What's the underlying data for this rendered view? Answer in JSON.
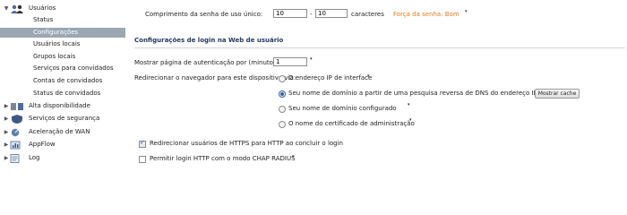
{
  "sidebar": {
    "sections": [
      {
        "label": "Usuários",
        "expanded": true,
        "icon": "users-icon"
      },
      {
        "label": "Alta disponibilidade",
        "icon": "high-availability-icon"
      },
      {
        "label": "Serviços de segurança",
        "icon": "security-services-icon"
      },
      {
        "label": "Aceleração de WAN",
        "icon": "wan-acceleration-icon"
      },
      {
        "label": "AppFlow",
        "icon": "appflow-icon"
      },
      {
        "label": "Log",
        "icon": "log-icon"
      }
    ],
    "users_children": [
      {
        "label": "Status"
      },
      {
        "label": "Configurações",
        "selected": true
      },
      {
        "label": "Usuários locais"
      },
      {
        "label": "Grupos locais"
      },
      {
        "label": "Serviços para convidados"
      },
      {
        "label": "Contas de convidados"
      },
      {
        "label": "Status de convidados"
      }
    ]
  },
  "password": {
    "label": "Comprimento da senha de uso único:",
    "min_value": "10",
    "separator": "-",
    "max_value": "10",
    "unit": "caracteres",
    "strength": "Força da senha: Bom",
    "strength_color": "#e07b1a"
  },
  "web_login": {
    "title": "Configurações de login na Web de usuário",
    "show_auth_label": "Mostrar página de autenticação por (minutos):",
    "show_auth_value": "1",
    "redirect_label": "Redirecionar o navegador para este dispositivo via:",
    "options": [
      {
        "label": "O endereço IP de interface",
        "checked": false
      },
      {
        "label": "Seu nome de domínio a partir de uma pesquisa reversa de DNS do endereço IP de interface",
        "checked": true
      },
      {
        "label": "Seu nome de domínio configurado",
        "checked": false
      },
      {
        "label": "O nome do certificado de administração",
        "checked": false
      }
    ],
    "show_cache_button": "Mostrar cache",
    "https_redirect": {
      "label": "Redirecionar usuários de HTTPS para HTTP ao concluir o login",
      "checked": true
    },
    "allow_http_chap": {
      "label": "Permitir login HTTP com o modo CHAP RADIUS",
      "checked": false
    }
  },
  "colors": {
    "selected_nav_bg": "#9aa7b3",
    "section_title": "#243a5e"
  }
}
